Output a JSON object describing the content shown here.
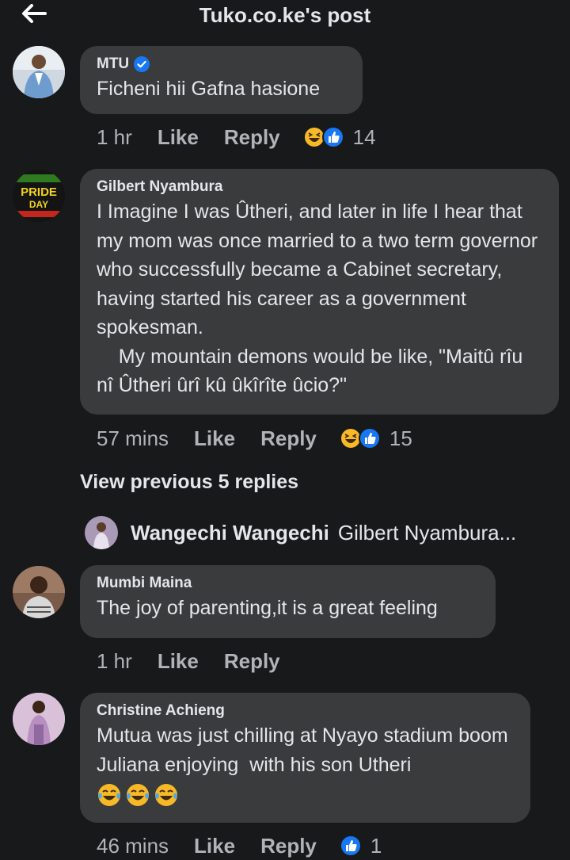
{
  "header": {
    "title": "Tuko.co.ke's post"
  },
  "comments": [
    {
      "name": "MTU",
      "verified": true,
      "text": "Ficheni hii Gafna hasione",
      "time": "1 hr",
      "like": "Like",
      "reply": "Reply",
      "reactions": [
        "haha",
        "like"
      ],
      "count": "14"
    },
    {
      "name": "Gilbert Nyambura",
      "avatar_text": "PRIDE",
      "avatar_text2": "DAY",
      "text": "I Imagine I was Ûtheri, and later in life I hear that my mom was once married to a two term governor who successfully became a Cabinet secretary, having started his career as a government spokesman.\n    My mountain demons would be like, \"Maitû rîu nî Ûtheri ûrî kû ûkîrîte ûcio?\"",
      "time": "57 mins",
      "like": "Like",
      "reply": "Reply",
      "reactions": [
        "haha",
        "like"
      ],
      "count": "15"
    },
    {
      "name": "Mumbi Maina",
      "text": "The joy of parenting,it is a great feeling",
      "time": "1 hr",
      "like": "Like",
      "reply": "Reply"
    },
    {
      "name": "Christine Achieng",
      "text": "Mutua was just chilling at Nyayo stadium boom Juliana enjoying  with his son Utheri",
      "emojis": "😂😂😂",
      "time": "46 mins",
      "like": "Like",
      "reply": "Reply",
      "reactions": [
        "like"
      ],
      "count": "1"
    }
  ],
  "view_previous": "View previous 5 replies",
  "reply_preview": {
    "name": "Wangechi Wangechi",
    "snippet": "Gilbert Nyambura..."
  },
  "colors": {
    "background": "#18191a",
    "bubble": "#3a3b3c",
    "text": "#e4e6eb",
    "secondary": "#b0b3b8",
    "like_blue": "#1877f2",
    "haha_yellow": "#f7b928"
  }
}
